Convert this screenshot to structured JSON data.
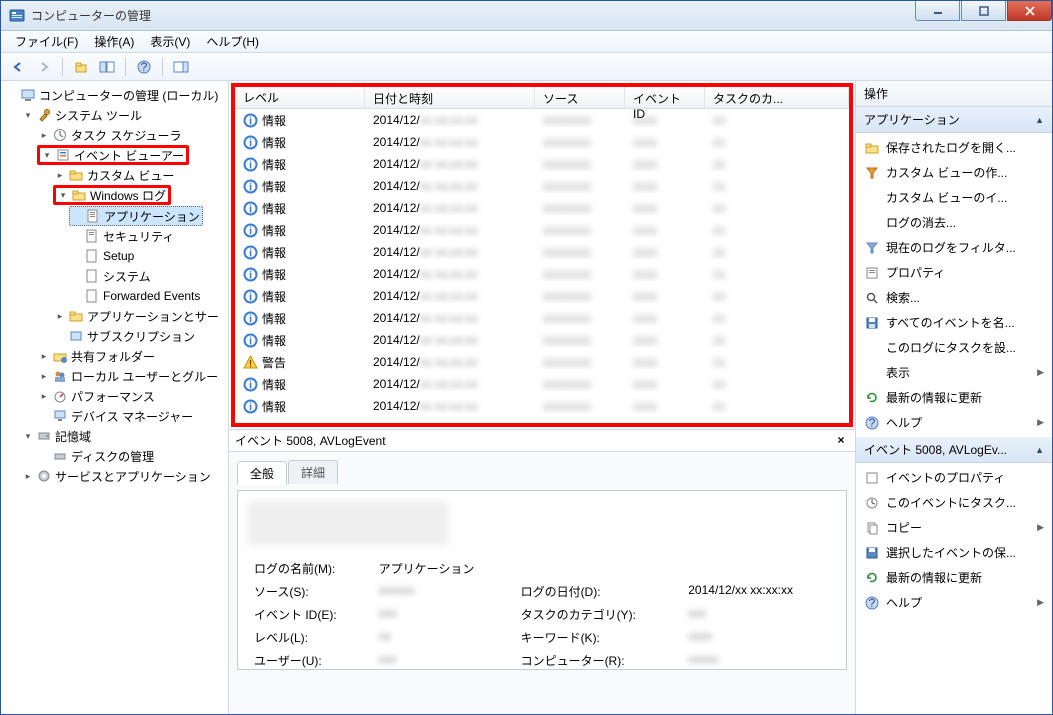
{
  "window": {
    "title": "コンピューターの管理"
  },
  "menubar": {
    "file": "ファイル(F)",
    "action": "操作(A)",
    "view": "表示(V)",
    "help": "ヘルプ(H)"
  },
  "tree": {
    "root": "コンピューターの管理 (ローカル)",
    "system_tools": "システム ツール",
    "task_scheduler": "タスク スケジューラ",
    "event_viewer": "イベント ビューアー",
    "custom_views": "カスタム ビュー",
    "windows_logs": "Windows ログ",
    "app": "アプリケーション",
    "security": "セキュリティ",
    "setup": "Setup",
    "system": "システム",
    "forwarded": "Forwarded Events",
    "apps_services": "アプリケーションとサー",
    "subscriptions": "サブスクリプション",
    "shared_folders": "共有フォルダー",
    "local_users": "ローカル ユーザーとグルー",
    "performance": "パフォーマンス",
    "device_mgr": "デバイス マネージャー",
    "storage": "記憶域",
    "disk_mgmt": "ディスクの管理",
    "services_apps": "サービスとアプリケーション"
  },
  "columns": {
    "level": "レベル",
    "date": "日付と時刻",
    "source": "ソース",
    "id": "イベント ID",
    "category": "タスクのカ..."
  },
  "level_labels": {
    "info": "情報",
    "warn": "警告"
  },
  "events": [
    {
      "level": "info",
      "date": "2014/12/"
    },
    {
      "level": "info",
      "date": "2014/12/"
    },
    {
      "level": "info",
      "date": "2014/12/"
    },
    {
      "level": "info",
      "date": "2014/12/"
    },
    {
      "level": "info",
      "date": "2014/12/"
    },
    {
      "level": "info",
      "date": "2014/12/"
    },
    {
      "level": "info",
      "date": "2014/12/"
    },
    {
      "level": "info",
      "date": "2014/12/"
    },
    {
      "level": "info",
      "date": "2014/12/"
    },
    {
      "level": "info",
      "date": "2014/12/"
    },
    {
      "level": "info",
      "date": "2014/12/"
    },
    {
      "level": "warn",
      "date": "2014/12/"
    },
    {
      "level": "info",
      "date": "2014/12/"
    },
    {
      "level": "info",
      "date": "2014/12/"
    }
  ],
  "detail": {
    "header": "イベント 5008, AVLogEvent",
    "tabs": {
      "general": "全般",
      "details": "詳細"
    },
    "fields": {
      "log_name_lbl": "ログの名前(M):",
      "log_name_val": "アプリケーション",
      "source_lbl": "ソース(S):",
      "event_id_lbl": "イベント ID(E):",
      "level_lbl": "レベル(L):",
      "user_lbl": "ユーザー(U):",
      "log_date_lbl": "ログの日付(D):",
      "log_date_val": "2014/12/",
      "task_cat_lbl": "タスクのカテゴリ(Y):",
      "keywords_lbl": "キーワード(K):",
      "computer_lbl": "コンピューター(R):"
    }
  },
  "actions": {
    "header": "操作",
    "section1": "アプリケーション",
    "items1": {
      "open_saved": "保存されたログを開く...",
      "create_custom": "カスタム ビューの作...",
      "import_custom": "カスタム ビューのイ...",
      "clear_log": "ログの消去...",
      "filter_current": "現在のログをフィルタ...",
      "properties": "プロパティ",
      "search": "検索...",
      "save_all": "すべてのイベントを名...",
      "attach_task": "このログにタスクを設...",
      "view": "表示",
      "refresh": "最新の情報に更新",
      "help": "ヘルプ"
    },
    "section2": "イベント 5008, AVLogEv...",
    "items2": {
      "event_props": "イベントのプロパティ",
      "attach_task_evt": "このイベントにタスク...",
      "copy": "コピー",
      "save_selected": "選択したイベントの保...",
      "refresh2": "最新の情報に更新",
      "help2": "ヘルプ"
    }
  }
}
